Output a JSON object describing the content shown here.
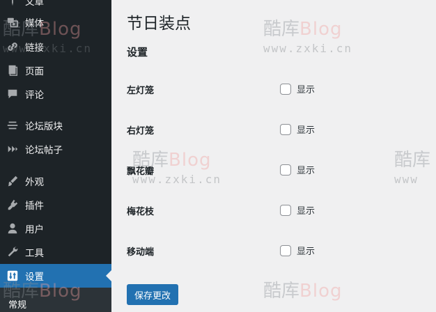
{
  "sidebar": {
    "items": [
      {
        "label": "文章",
        "icon": "pin-icon"
      },
      {
        "label": "媒体",
        "icon": "media-icon"
      },
      {
        "label": "链接",
        "icon": "link-icon"
      },
      {
        "label": "页面",
        "icon": "page-icon"
      },
      {
        "label": "评论",
        "icon": "comment-icon"
      },
      {
        "label": "论坛版块",
        "icon": "forum-icon"
      },
      {
        "label": "论坛帖子",
        "icon": "topic-icon"
      },
      {
        "label": "外观",
        "icon": "brush-icon"
      },
      {
        "label": "插件",
        "icon": "plugin-icon"
      },
      {
        "label": "用户",
        "icon": "user-icon"
      },
      {
        "label": "工具",
        "icon": "wrench-icon"
      },
      {
        "label": "设置",
        "icon": "settings-icon"
      }
    ],
    "active": "设置",
    "submenu": {
      "first": "常规"
    }
  },
  "main": {
    "title": "节日装点",
    "section": "设置",
    "rows": [
      {
        "label": "左灯笼",
        "option": "显示",
        "checked": false
      },
      {
        "label": "右灯笼",
        "option": "显示",
        "checked": false
      },
      {
        "label": "飘花瓣",
        "option": "显示",
        "checked": false
      },
      {
        "label": "梅花枝",
        "option": "显示",
        "checked": false
      },
      {
        "label": "移动端",
        "option": "显示",
        "checked": false
      }
    ],
    "save_label": "保存更改"
  },
  "watermark": {
    "cn": "酷库",
    "en": "Blog",
    "url": "www.zxki.cn"
  },
  "colors": {
    "sidebar_bg": "#1d2327",
    "active_bg": "#2271b1",
    "content_bg": "#f0f0f1",
    "button_bg": "#2271b1"
  }
}
